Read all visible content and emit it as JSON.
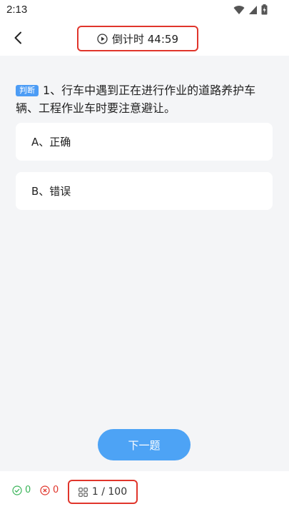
{
  "status_bar": {
    "time": "2:13"
  },
  "header": {
    "timer_text": "倒计时 44:59"
  },
  "question": {
    "tag": "判断",
    "text": "1、行车中遇到正在进行作业的道路养护车辆、工程作业车时要注意避让。"
  },
  "options": [
    {
      "label": "A、正确"
    },
    {
      "label": "B、错误"
    }
  ],
  "next_button": {
    "label": "下一题"
  },
  "footer": {
    "correct_count": "0",
    "wrong_count": "0",
    "progress": "1 / 100"
  },
  "colors": {
    "accent": "#4da3f5",
    "highlight_border": "#e0352b",
    "correct": "#3bb55a",
    "wrong": "#e0352b",
    "background": "#f4f5f7"
  },
  "icons": [
    "wifi-icon",
    "signal-icon",
    "battery-icon",
    "back-arrow-icon",
    "play-circle-icon",
    "check-circle-icon",
    "cross-circle-icon",
    "grid-icon"
  ]
}
